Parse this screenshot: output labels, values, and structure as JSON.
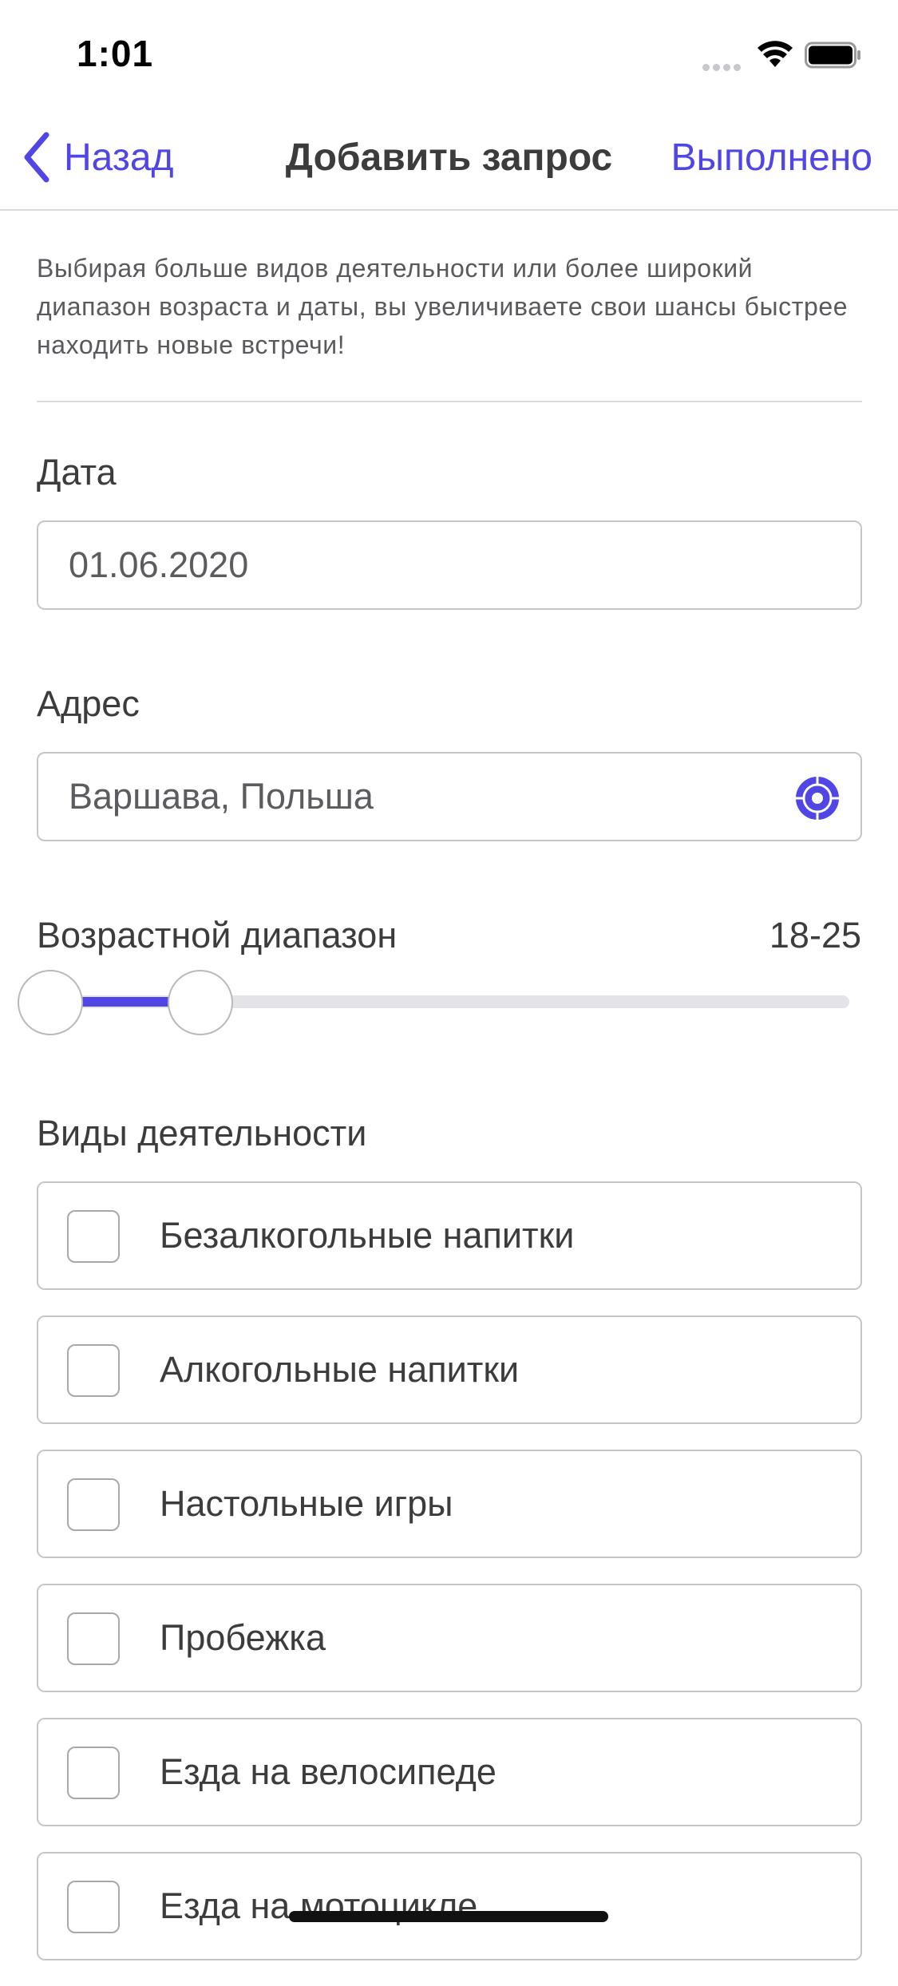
{
  "status_bar": {
    "time": "1:01"
  },
  "nav": {
    "back_label": "Назад",
    "title": "Добавить запрос",
    "done_label": "Выполнено"
  },
  "hint": "Выбирая больше видов деятельности или более широкий диапазон возраста и даты, вы увеличиваете свои шансы быстрее находить новые встречи!",
  "date_field": {
    "label": "Дата",
    "value": "01.06.2020"
  },
  "address_field": {
    "label": "Адрес",
    "value": "Варшава, Польша",
    "icon": "location-target-icon"
  },
  "age_range": {
    "label": "Возрастной диапазон",
    "value_text": "18-25",
    "min": 18,
    "max": 25
  },
  "activities": {
    "label": "Виды деятельности",
    "items": [
      {
        "label": "Безалкогольные напитки",
        "checked": false
      },
      {
        "label": "Алкогольные напитки",
        "checked": false
      },
      {
        "label": "Настольные игры",
        "checked": false
      },
      {
        "label": "Пробежка",
        "checked": false
      },
      {
        "label": "Езда на велосипеде",
        "checked": false
      },
      {
        "label": "Езда на мотоцикле",
        "checked": false
      }
    ]
  },
  "colors": {
    "accent": "#5146e5",
    "border": "#c6c6cb",
    "text": "#3c3c3e"
  }
}
